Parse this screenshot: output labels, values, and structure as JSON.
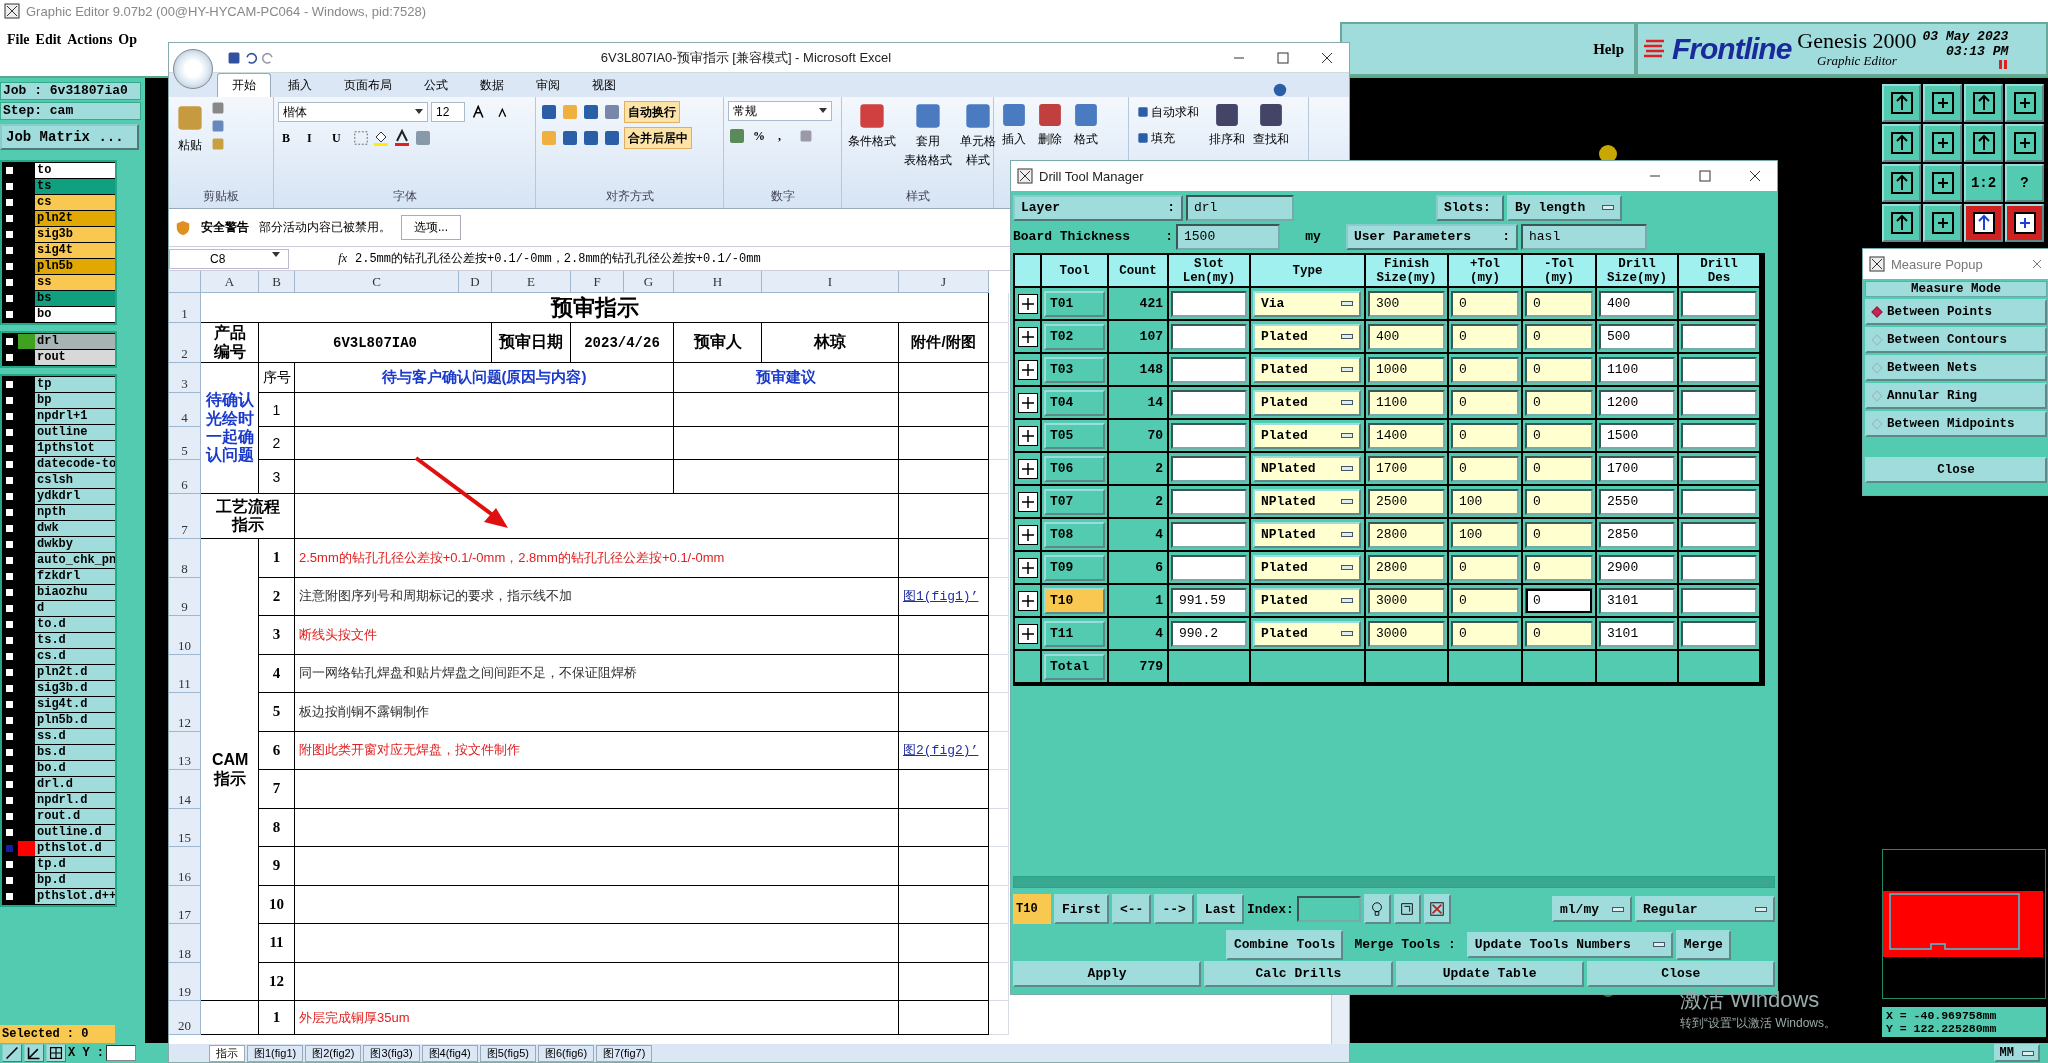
{
  "genesis": {
    "title": "Graphic Editor 9.07b2 (00@HY-HYCAM-PC064 - Windows, pid:7528)",
    "menu": [
      {
        "label": "File",
        "selected": false
      },
      {
        "label": "Edit",
        "selected": false
      },
      {
        "label": "Actions",
        "selected": false
      },
      {
        "label": "Op",
        "selected": false
      }
    ],
    "help": "Help",
    "logo": "Frontline",
    "product": "Genesis 2000",
    "subtitle": "Graphic Editor",
    "date": "03 May 2023",
    "time": "03:13 PM",
    "job": "Job : 6v31807ia0",
    "step": "Step: cam",
    "job_matrix": "Job Matrix ...",
    "layer_groups": [
      {
        "layers": [
          {
            "name": "to",
            "color": "#ffffff",
            "affected": false
          },
          {
            "name": "ts",
            "color": "#10a080",
            "affected": false
          },
          {
            "name": "cs",
            "color": "#f8c850",
            "affected": false
          },
          {
            "name": "pln2t",
            "color": "#e0a800",
            "affected": false
          },
          {
            "name": "sig3b",
            "color": "#f8c850",
            "affected": false
          },
          {
            "name": "sig4t",
            "color": "#f8c850",
            "affected": false
          },
          {
            "name": "pln5b",
            "color": "#e0a800",
            "affected": false
          },
          {
            "name": "ss",
            "color": "#f8c850",
            "affected": false
          },
          {
            "name": "bs",
            "color": "#10a080",
            "affected": false
          },
          {
            "name": "bo",
            "color": "#ffffff",
            "affected": false
          }
        ]
      },
      {
        "layers": [
          {
            "name": "drl",
            "color": "#a8b4b4",
            "marker": {
              "color": "#40a020"
            },
            "affected": false
          },
          {
            "name": "rout",
            "color": "#d8d8d8",
            "affected": false
          }
        ]
      },
      {
        "layers": [
          {
            "name": "tp",
            "color": "#a0dcdc",
            "affected": false
          },
          {
            "name": "bp",
            "color": "#a0dcdc",
            "affected": false
          },
          {
            "name": "npdrl+1",
            "color": "#a0dcdc",
            "affected": false
          },
          {
            "name": "outline",
            "color": "#a0dcdc",
            "affected": false
          },
          {
            "name": "1pthslot",
            "color": "#a0dcdc",
            "affected": false
          },
          {
            "name": "datecode-to",
            "color": "#a0dcdc",
            "affected": false
          },
          {
            "name": "cslsh",
            "color": "#a0dcdc",
            "affected": false
          },
          {
            "name": "ydkdrl",
            "color": "#a0dcdc",
            "affected": false
          },
          {
            "name": "npth",
            "color": "#a0dcdc",
            "affected": false
          },
          {
            "name": "dwk",
            "color": "#a0dcdc",
            "affected": false
          },
          {
            "name": "dwkby",
            "color": "#a0dcdc",
            "affected": false
          },
          {
            "name": "auto_chk_pn",
            "color": "#a0dcdc",
            "affected": false
          },
          {
            "name": "fzkdrl",
            "color": "#a0dcdc",
            "affected": false
          },
          {
            "name": "biaozhu",
            "color": "#a0dcdc",
            "affected": false
          },
          {
            "name": "d",
            "color": "#a0dcdc",
            "affected": false
          },
          {
            "name": "to.d",
            "color": "#a0dcdc",
            "affected": false
          },
          {
            "name": "ts.d",
            "color": "#a0dcdc",
            "affected": false
          },
          {
            "name": "cs.d",
            "color": "#a0dcdc",
            "affected": false
          },
          {
            "name": "pln2t.d",
            "color": "#a0dcdc",
            "affected": false
          },
          {
            "name": "sig3b.d",
            "color": "#a0dcdc",
            "affected": false
          },
          {
            "name": "sig4t.d",
            "color": "#a0dcdc",
            "affected": false
          },
          {
            "name": "pln5b.d",
            "color": "#a0dcdc",
            "affected": false
          },
          {
            "name": "ss.d",
            "color": "#a0dcdc",
            "affected": false
          },
          {
            "name": "bs.d",
            "color": "#a0dcdc",
            "affected": false
          },
          {
            "name": "bo.d",
            "color": "#a0dcdc",
            "affected": false
          },
          {
            "name": "drl.d",
            "color": "#a0dcdc",
            "affected": false
          },
          {
            "name": "npdrl.d",
            "color": "#a0dcdc",
            "affected": false
          },
          {
            "name": "rout.d",
            "color": "#a0dcdc",
            "affected": false
          },
          {
            "name": "outline.d",
            "color": "#a0dcdc",
            "affected": false
          },
          {
            "name": "pthslot.d",
            "color": "#a0dcdc",
            "marker": {
              "color": "#ff0000"
            },
            "affected": true
          },
          {
            "name": "tp.d",
            "color": "#a0dcdc",
            "affected": false
          },
          {
            "name": "bp.d",
            "color": "#a0dcdc",
            "affected": false
          },
          {
            "name": "pthslot.d++",
            "color": "#a0dcdc",
            "affected": false
          }
        ]
      }
    ],
    "selected_count": "Selected : 0",
    "xy_label": "X Y :",
    "toolbar_text": [
      "1:2",
      "?"
    ],
    "coords": [
      "X = -40.969758mm",
      "Y = 122.225280mm"
    ],
    "units": "MM"
  },
  "excel": {
    "title": "6V3L807IA0-预审指示  [兼容模式] - Microsoft Excel",
    "tabs": [
      {
        "label": "开始",
        "selected": true
      },
      {
        "label": "插入",
        "selected": false
      },
      {
        "label": "页面布局",
        "selected": false
      },
      {
        "label": "公式",
        "selected": false
      },
      {
        "label": "数据",
        "selected": false
      },
      {
        "label": "审阅",
        "selected": false
      },
      {
        "label": "视图",
        "selected": false
      }
    ],
    "ribbon": {
      "paste": "粘贴",
      "clipboard": "剪贴板",
      "font_name": "楷体",
      "font_size": "12",
      "font_styles": [
        "B",
        "I",
        "U"
      ],
      "font": "字体",
      "wrap": "自动换行",
      "merge": "合并后居中",
      "alignment": "对齐方式",
      "number_format": "常规",
      "number_symbols": [
        "%",
        ","
      ],
      "number": "数字",
      "styles": [
        {
          "lines": [
            "条件格式"
          ]
        },
        {
          "lines": [
            "套用",
            "表格格式"
          ]
        },
        {
          "lines": [
            "单元格",
            "样式"
          ]
        }
      ],
      "styles_group": "样式",
      "cells": [
        "插入",
        "删除",
        "格式"
      ],
      "editing": [
        "自动求和",
        "填充"
      ],
      "sort": [
        "排序和",
        "查找和"
      ]
    },
    "security": {
      "title": "安全警告",
      "message": "部分活动内容已被禁用。",
      "button": "选项..."
    },
    "name_box": "C8",
    "fx": "fx",
    "formula": "2.5mm的钻孔孔径公差按+0.1/-0mm，2.8mm的钻孔孔径公差按+0.1/-0mm",
    "columns": [
      "A",
      "B",
      "C",
      "D",
      "E",
      "F",
      "G",
      "H",
      "I",
      "J"
    ],
    "rows": [
      "1",
      "2",
      "3",
      "4",
      "5",
      "6",
      "7",
      "8",
      "9",
      "10",
      "11",
      "12",
      "13",
      "14",
      "15",
      "16",
      "17",
      "18",
      "19",
      "20"
    ],
    "sheet": {
      "title": "预审指示",
      "product_label": "产品编号",
      "product": "6V3L807IA0",
      "date_label": "预审日期",
      "date": "2023/4/26",
      "reviewer_label": "预审人",
      "reviewer": "林琼",
      "attach_label": "附件/附图",
      "confirm": {
        "label": "待确认光绘时一起确认问题",
        "no_header": "序号",
        "question_header": "待与客户确认问题(原因与内容)",
        "suggest_header": "预审建议",
        "items": [
          "1",
          "2",
          "3"
        ]
      },
      "process_label": "工艺流程指示",
      "cam": {
        "label": "CAM指示",
        "items": [
          {
            "no": "1",
            "text": "2.5mm的钻孔孔径公差按+0.1/-0mm，2.8mm的钻孔孔径公差按+0.1/-0mm",
            "color": "#e02020"
          },
          {
            "no": "2",
            "text": "注意附图序列号和周期标记的要求，指示线不加",
            "color": "#303030",
            "attachment": "图1(fig1)’"
          },
          {
            "no": "3",
            "text": "断线头按文件",
            "color": "#e02020"
          },
          {
            "no": "4",
            "text": "同一网络钻孔焊盘和贴片焊盘之间间距不足，不保证阻焊桥",
            "color": "#303030"
          },
          {
            "no": "5",
            "text": "板边按削铜不露铜制作",
            "color": "#303030"
          },
          {
            "no": "6",
            "text": "附图此类开窗对应无焊盘，按文件制作",
            "color": "#e02020",
            "attachment": "图2(fig2)’"
          },
          {
            "no": "7"
          },
          {
            "no": "8"
          },
          {
            "no": "9"
          },
          {
            "no": "10"
          },
          {
            "no": "11"
          },
          {
            "no": "12"
          }
        ]
      },
      "last": {
        "no": "1",
        "text": "外层完成铜厚35um",
        "color": "#e02020"
      }
    },
    "sheet_tabs": [
      {
        "label": "指示",
        "selected": true
      },
      {
        "label": "图1(fig1)",
        "selected": false
      },
      {
        "label": "图2(fig2)",
        "selected": false
      },
      {
        "label": "图3(fig3)",
        "selected": false
      },
      {
        "label": "图4(fig4)",
        "selected": false
      },
      {
        "label": "图5(fig5)",
        "selected": false
      },
      {
        "label": "图6(fig6)",
        "selected": false
      },
      {
        "label": "图7(fig7)",
        "selected": false
      }
    ]
  },
  "drill": {
    "title": "Drill Tool Manager",
    "layer": {
      "label": "Layer",
      "sep": ":",
      "value": "drl"
    },
    "slots": {
      "label": "Slots:",
      "value": "By length"
    },
    "thickness": {
      "label": "Board Thickness",
      "sep": ":",
      "value": "1500",
      "unit": "my"
    },
    "user_params": {
      "label": "User Parameters",
      "sep": ":",
      "value": "hasl"
    },
    "columns": [
      {
        "lines": [
          "Tool"
        ]
      },
      {
        "lines": [
          "Count"
        ]
      },
      {
        "lines": [
          "Slot",
          "Len(my)"
        ]
      },
      {
        "lines": [
          "Type"
        ]
      },
      {
        "lines": [
          "Finish",
          "Size(my)"
        ]
      },
      {
        "lines": [
          "+Tol",
          "(my)"
        ]
      },
      {
        "lines": [
          "-Tol",
          "(my)"
        ]
      },
      {
        "lines": [
          "Drill",
          "Size(my)"
        ]
      },
      {
        "lines": [
          "Drill",
          "Des"
        ]
      }
    ],
    "tools": [
      {
        "tool": "T01",
        "count": "421",
        "type": "Via",
        "finish": "300",
        "plus_tol": "0",
        "minus_tol": "0",
        "drill": "400",
        "selected": false
      },
      {
        "tool": "T02",
        "count": "107",
        "type": "Plated",
        "finish": "400",
        "plus_tol": "0",
        "minus_tol": "0",
        "drill": "500",
        "selected": false
      },
      {
        "tool": "T03",
        "count": "148",
        "type": "Plated",
        "finish": "1000",
        "plus_tol": "0",
        "minus_tol": "0",
        "drill": "1100",
        "selected": false
      },
      {
        "tool": "T04",
        "count": "14",
        "type": "Plated",
        "finish": "1100",
        "plus_tol": "0",
        "minus_tol": "0",
        "drill": "1200",
        "selected": false
      },
      {
        "tool": "T05",
        "count": "70",
        "type": "Plated",
        "finish": "1400",
        "plus_tol": "0",
        "minus_tol": "0",
        "drill": "1500",
        "selected": false
      },
      {
        "tool": "T06",
        "count": "2",
        "type": "NPlated",
        "finish": "1700",
        "plus_tol": "0",
        "minus_tol": "0",
        "drill": "1700",
        "selected": false
      },
      {
        "tool": "T07",
        "count": "2",
        "type": "NPlated",
        "finish": "2500",
        "plus_tol": "100",
        "minus_tol": "0",
        "drill": "2550",
        "selected": false
      },
      {
        "tool": "T08",
        "count": "4",
        "type": "NPlated",
        "finish": "2800",
        "plus_tol": "100",
        "minus_tol": "0",
        "drill": "2850",
        "selected": false
      },
      {
        "tool": "T09",
        "count": "6",
        "type": "Plated",
        "finish": "2800",
        "plus_tol": "0",
        "minus_tol": "0",
        "drill": "2900",
        "selected": false
      },
      {
        "tool": "T10",
        "count": "1",
        "slot_len": "991.59",
        "type": "Plated",
        "finish": "3000",
        "plus_tol": "0",
        "minus_tol": "0",
        "drill": "3101",
        "selected": true
      },
      {
        "tool": "T11",
        "count": "4",
        "slot_len": "990.2",
        "type": "Plated",
        "finish": "3000",
        "plus_tol": "0",
        "minus_tol": "0",
        "drill": "3101",
        "selected": false
      }
    ],
    "total": {
      "label": "Total",
      "count": "779"
    },
    "current": "T10",
    "nav": [
      "First",
      "<--",
      "-->",
      "Last"
    ],
    "index_label": "Index:",
    "units": "ml/my",
    "mode": "Regular",
    "combine": "Combine Tools",
    "merge_label": "Merge Tools :",
    "merge_mode": "Update Tools Numbers",
    "merge": "Merge",
    "actions": [
      "Apply",
      "Calc Drills",
      "Update Table",
      "Close"
    ]
  },
  "measure": {
    "title": "Measure Popup",
    "mode_label": "Measure Mode",
    "options": [
      {
        "label": "Between Points",
        "selected": true
      },
      {
        "label": "Between Contours",
        "selected": false
      },
      {
        "label": "Between Nets",
        "selected": false
      },
      {
        "label": "Annular Ring",
        "selected": false
      },
      {
        "label": "Between Midpoints",
        "selected": false
      }
    ],
    "close": "Close"
  },
  "activation": {
    "title": "激活 Windows",
    "message": "转到“设置”以激活 Windows。"
  }
}
